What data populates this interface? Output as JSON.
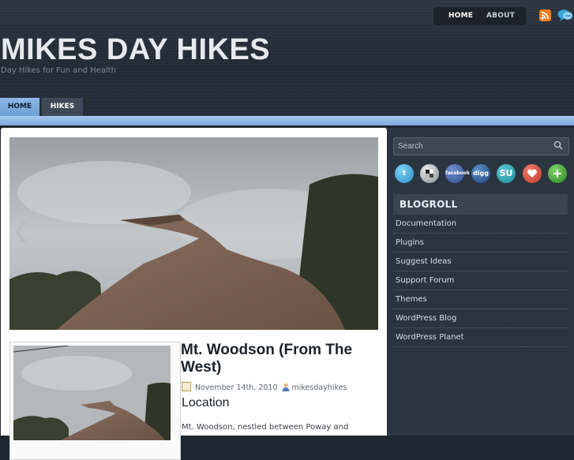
{
  "header": {
    "site_title": "MIKES DAY HIKES",
    "tagline": "Day Hikes for Fun and Health",
    "top_nav": [
      "HOME",
      "ABOUT"
    ],
    "main_nav": [
      "HOME",
      "HIKES"
    ]
  },
  "post": {
    "title": "Mt. Woodson (From The West)",
    "date": "November 14th, 2010",
    "author": "mikesdayhikes",
    "section_heading": "Location",
    "excerpt": "Mt.  Woodson,  nestled  between  Poway  and"
  },
  "sidebar": {
    "search_placeholder": "Search",
    "social_icons": [
      "twitter-icon",
      "delicious-icon",
      "facebook-icon",
      "digg-icon",
      "stumbleupon-icon",
      "favorite-icon",
      "add-icon"
    ],
    "blogroll_title": "BLOGROLL",
    "blogroll": [
      "Documentation",
      "Plugins",
      "Suggest Ideas",
      "Support Forum",
      "Themes",
      "WordPress Blog",
      "WordPress Planet"
    ]
  },
  "colors": {
    "header_bg": "#252e38",
    "accent_blue": "#7aa8de",
    "sidebar_bg": "#2b3540",
    "rss_orange": "#f07c1c"
  }
}
